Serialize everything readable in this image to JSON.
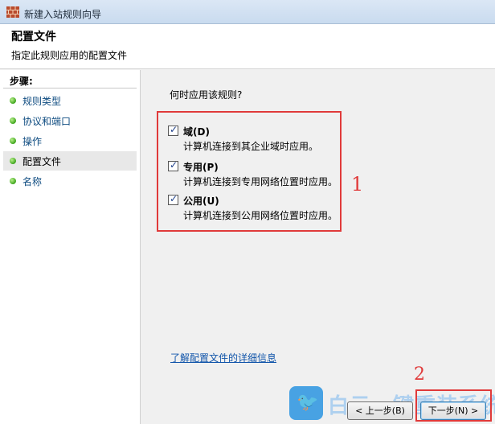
{
  "window": {
    "title": "新建入站规则向导"
  },
  "header": {
    "title": "配置文件",
    "description": "指定此规则应用的配置文件"
  },
  "sidebar": {
    "steps_label": "步骤:",
    "items": [
      {
        "label": "规则类型"
      },
      {
        "label": "协议和端口"
      },
      {
        "label": "操作"
      },
      {
        "label": "配置文件",
        "active": true
      },
      {
        "label": "名称"
      }
    ]
  },
  "main": {
    "question": "何时应用该规则?",
    "options": [
      {
        "name": "域(D)",
        "desc": "计算机连接到其企业域时应用。",
        "checked": true
      },
      {
        "name": "专用(P)",
        "desc": "计算机连接到专用网络位置时应用。",
        "checked": true
      },
      {
        "name": "公用(U)",
        "desc": "计算机连接到公用网络位置时应用。",
        "checked": true
      }
    ],
    "help_link": "了解配置文件的详细信息"
  },
  "buttons": {
    "back": "< 上一步(B)",
    "next": "下一步(N) >"
  },
  "annotations": {
    "one": "1",
    "two": "2"
  },
  "watermark": {
    "text": "白云一键重装系统"
  },
  "colors": {
    "accent_red": "#e03a3a",
    "link": "#1155aa",
    "step_dot": "#3fa51e"
  }
}
